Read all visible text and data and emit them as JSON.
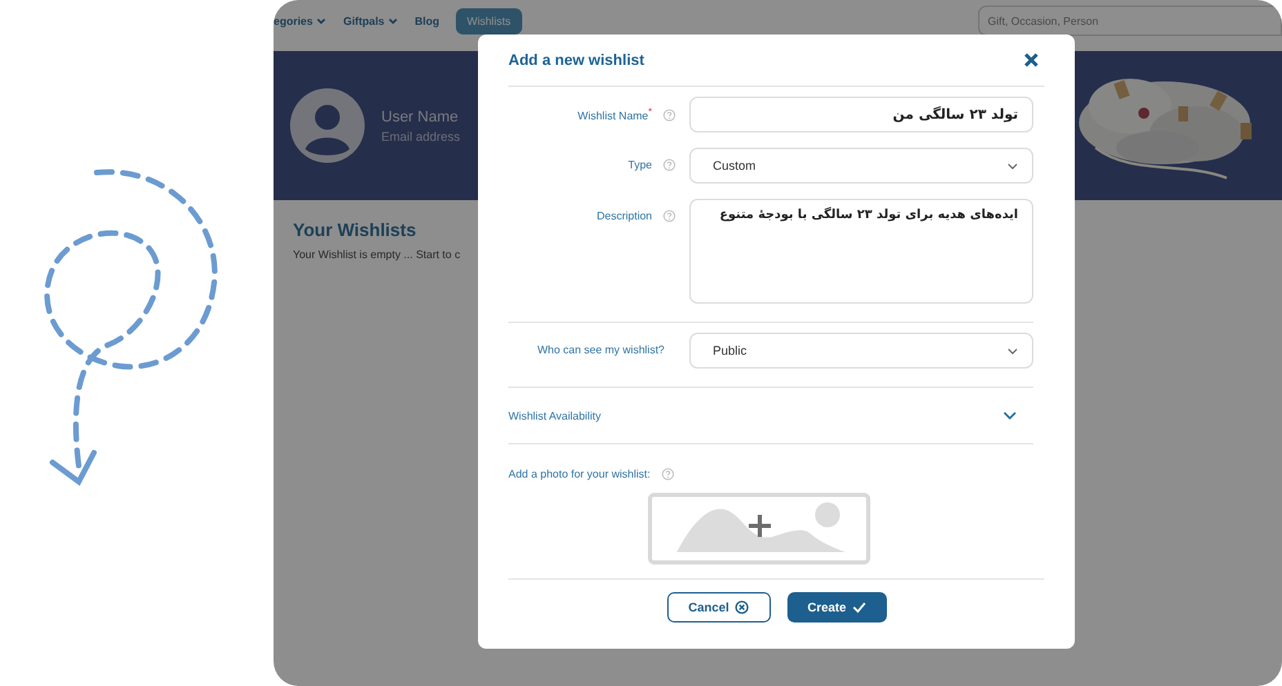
{
  "nav": {
    "items": [
      {
        "label": "egories",
        "dropdown": true,
        "selected": false
      },
      {
        "label": "Giftpals",
        "dropdown": true,
        "selected": false
      },
      {
        "label": "Blog",
        "dropdown": false,
        "selected": false
      },
      {
        "label": "Wishlists",
        "dropdown": false,
        "selected": true
      }
    ],
    "search": {
      "placeholder": "Gift, Occasion, Person"
    }
  },
  "profile": {
    "name": "User Name",
    "email": "Email address"
  },
  "wishlists": {
    "title": "Your Wishlists",
    "message": "Your Wishlist is empty ... Start to c"
  },
  "modal": {
    "title": "Add a new wishlist",
    "fields": [
      {
        "kind": "text",
        "label": "Wishlist Name",
        "required_mark": "*",
        "help": true,
        "value": "تولد ۲۳ سالگی من"
      },
      {
        "kind": "select",
        "label": "Type",
        "help": true,
        "value": "Custom"
      },
      {
        "kind": "textarea",
        "label": "Description",
        "help": true,
        "value": "ایده‌های هدیه برای تولد ۲۳ سالگی با بودجهٔ متنوع"
      },
      {
        "kind": "select",
        "label": "Who can see my wishlist?",
        "help": false,
        "value": "Public"
      }
    ],
    "availability": {
      "label": "Wishlist Availability",
      "expanded": false
    },
    "photo": {
      "label": "Add a photo for your wishlist:",
      "help": true
    },
    "buttons": [
      {
        "kind": "secondary",
        "label": "Cancel"
      },
      {
        "kind": "primary",
        "label": "Create"
      }
    ]
  }
}
